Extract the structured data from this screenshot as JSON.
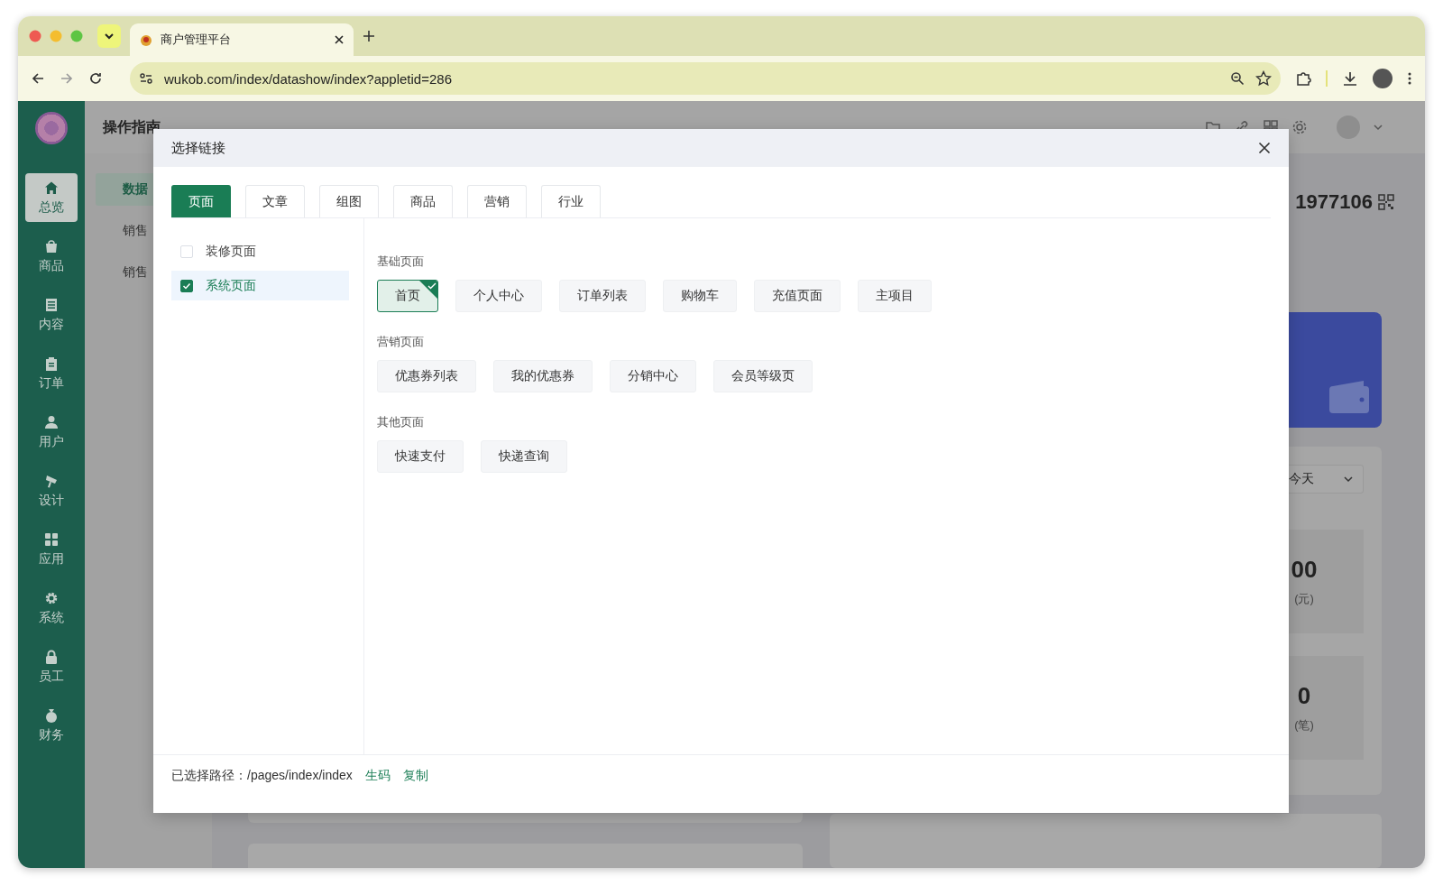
{
  "browser": {
    "tab_title": "商户管理平台",
    "url": "wukob.com/index/datashow/index?appletid=286"
  },
  "sidebar": {
    "items": [
      {
        "label": "总览",
        "selected": true
      },
      {
        "label": "商品",
        "selected": false
      },
      {
        "label": "内容",
        "selected": false
      },
      {
        "label": "订单",
        "selected": false
      },
      {
        "label": "用户",
        "selected": false
      },
      {
        "label": "设计",
        "selected": false
      },
      {
        "label": "应用",
        "selected": false
      },
      {
        "label": "系统",
        "selected": false
      },
      {
        "label": "员工",
        "selected": false
      },
      {
        "label": "财务",
        "selected": false
      }
    ]
  },
  "page": {
    "header_title": "操作指南",
    "submenu": [
      {
        "label": "数据",
        "selected": true
      },
      {
        "label": "销售",
        "selected": false
      },
      {
        "label": "销售",
        "selected": false
      }
    ],
    "store_id": "1977106",
    "period_select": "今天",
    "stats": [
      {
        "value": "00",
        "unit": "(元)"
      },
      {
        "value": "0",
        "unit": "(笔)"
      }
    ]
  },
  "dialog": {
    "title": "选择链接",
    "tabs": [
      {
        "label": "页面",
        "selected": true
      },
      {
        "label": "文章",
        "selected": false
      },
      {
        "label": "组图",
        "selected": false
      },
      {
        "label": "商品",
        "selected": false
      },
      {
        "label": "营销",
        "selected": false
      },
      {
        "label": "行业",
        "selected": false
      }
    ],
    "categories": [
      {
        "label": "装修页面",
        "checked": false
      },
      {
        "label": "系统页面",
        "checked": true
      }
    ],
    "sections": [
      {
        "title": "基础页面",
        "links": [
          {
            "label": "首页",
            "selected": true
          },
          {
            "label": "个人中心",
            "selected": false
          },
          {
            "label": "订单列表",
            "selected": false
          },
          {
            "label": "购物车",
            "selected": false
          },
          {
            "label": "充值页面",
            "selected": false
          },
          {
            "label": "主项目",
            "selected": false
          }
        ]
      },
      {
        "title": "营销页面",
        "links": [
          {
            "label": "优惠券列表",
            "selected": false
          },
          {
            "label": "我的优惠券",
            "selected": false
          },
          {
            "label": "分销中心",
            "selected": false
          },
          {
            "label": "会员等级页",
            "selected": false
          }
        ]
      },
      {
        "title": "其他页面",
        "links": [
          {
            "label": "快速支付",
            "selected": false
          },
          {
            "label": "快递查询",
            "selected": false
          }
        ]
      }
    ],
    "footer": {
      "label": "已选择路径：",
      "path": "/pages/index/index",
      "actions": [
        "生码",
        "复制"
      ]
    }
  }
}
